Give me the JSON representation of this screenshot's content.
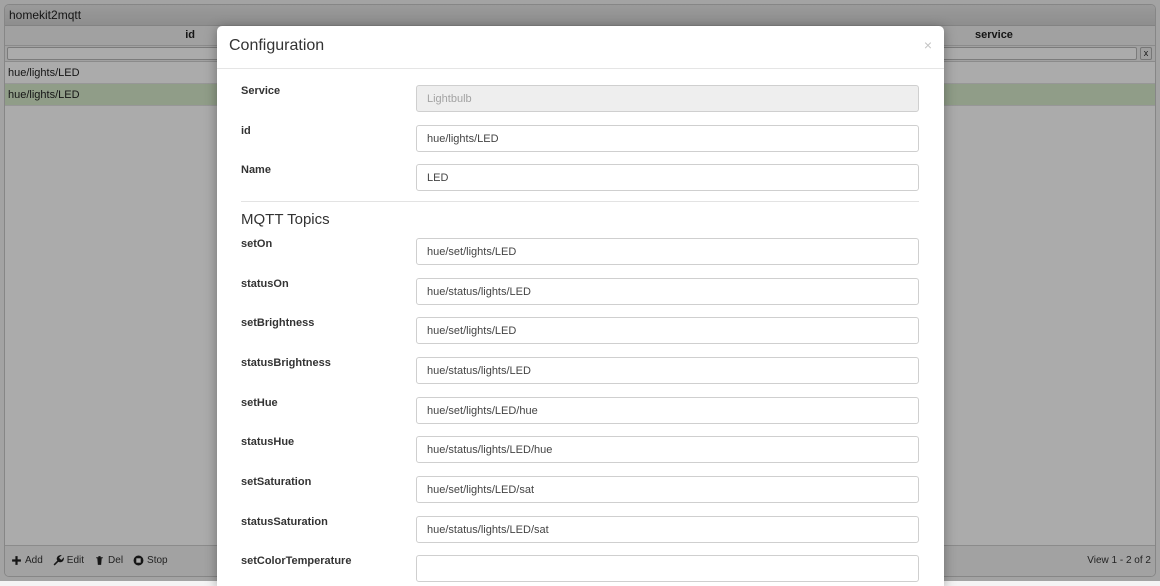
{
  "app": {
    "title": "homekit2mqtt",
    "columns": {
      "id": "id",
      "service": "service"
    },
    "filter_clear": "x",
    "rows": [
      {
        "id": "hue/lights/LED",
        "selected": false
      },
      {
        "id": "hue/lights/LED",
        "selected": true
      }
    ],
    "footer": {
      "add": "Add",
      "edit": "Edit",
      "del": "Del",
      "stop": "Stop",
      "view_info": "View 1 - 2 of 2"
    }
  },
  "modal": {
    "title": "Configuration",
    "close": "×",
    "fields": {
      "service": {
        "label": "Service",
        "value": "Lightbulb"
      },
      "id": {
        "label": "id",
        "value": "hue/lights/LED"
      },
      "name": {
        "label": "Name",
        "value": "LED"
      }
    },
    "section_mqtt": "MQTT Topics",
    "topics": [
      {
        "label": "setOn",
        "value": "hue/set/lights/LED"
      },
      {
        "label": "statusOn",
        "value": "hue/status/lights/LED"
      },
      {
        "label": "setBrightness",
        "value": "hue/set/lights/LED"
      },
      {
        "label": "statusBrightness",
        "value": "hue/status/lights/LED"
      },
      {
        "label": "setHue",
        "value": "hue/set/lights/LED/hue"
      },
      {
        "label": "statusHue",
        "value": "hue/status/lights/LED/hue"
      },
      {
        "label": "setSaturation",
        "value": "hue/set/lights/LED/sat"
      },
      {
        "label": "statusSaturation",
        "value": "hue/status/lights/LED/sat"
      },
      {
        "label": "setColorTemperature",
        "value": ""
      }
    ]
  },
  "colors": {
    "selected_row": "#d7ebcb",
    "overlay": "rgba(0,0,0,0.33)"
  },
  "icons": [
    "plus-icon",
    "wrench-icon",
    "trash-icon",
    "stop-icon"
  ]
}
